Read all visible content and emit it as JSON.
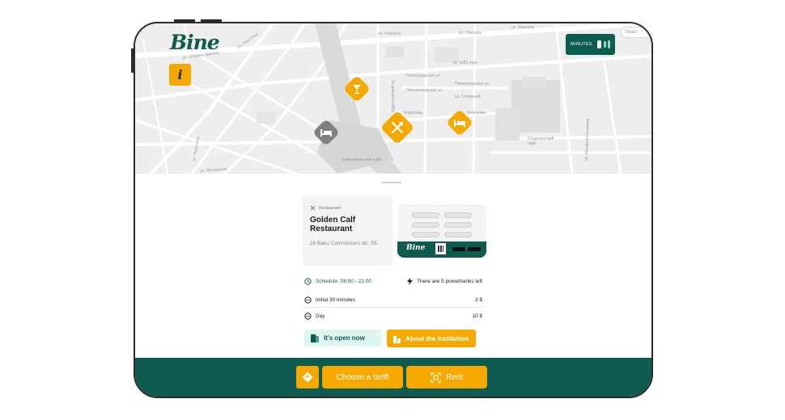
{
  "app": {
    "logo_text": "Bine"
  },
  "map": {
    "search_placeholder": "Searc",
    "minutes_label": "MINUTES",
    "info_glyph": "i",
    "streets": [
      "ул. Фёдора Эденіна",
      "ул. Портляна",
      "ул. Нансена",
      "ул. Нансена",
      "ул. Нансена",
      "ул. 1905 года",
      "Пинвоградская ул.",
      "Пинвоградская ул.",
      "ул. Отварный",
      "Пенкагородская ул.",
      "Студенческий парк",
      "Комсомольский парк",
      "ул. Мечникова",
      "ул. Портляна",
      "пр. Михаила Нагибина",
      "Бофонарь",
      "Бофонарь",
      "Будённовский пр."
    ]
  },
  "place": {
    "category": "Restaurant",
    "name": "Golden Calf Restaurant",
    "address": "26 Baku Commissars str., 55"
  },
  "station": {
    "logo_text": "Bine"
  },
  "info": {
    "schedule": "Schedule: 08:00 - 21:00",
    "powerbanks": "There are 5 powerbanks left",
    "tariffs": [
      {
        "label": "Initial 30 minutes",
        "price": "3 $"
      },
      {
        "label": "Day",
        "price": "10 $"
      }
    ]
  },
  "actions": {
    "open_now": "It's open now",
    "about": "About the Institution"
  },
  "footer": {
    "choose_tariff": "Choose a tariff",
    "rent": "Rent"
  },
  "colors": {
    "brand_green": "#0f5b4f",
    "accent_orange": "#f5a800",
    "pin_gray": "#808080",
    "open_chip_bg": "#ddf6f2"
  }
}
